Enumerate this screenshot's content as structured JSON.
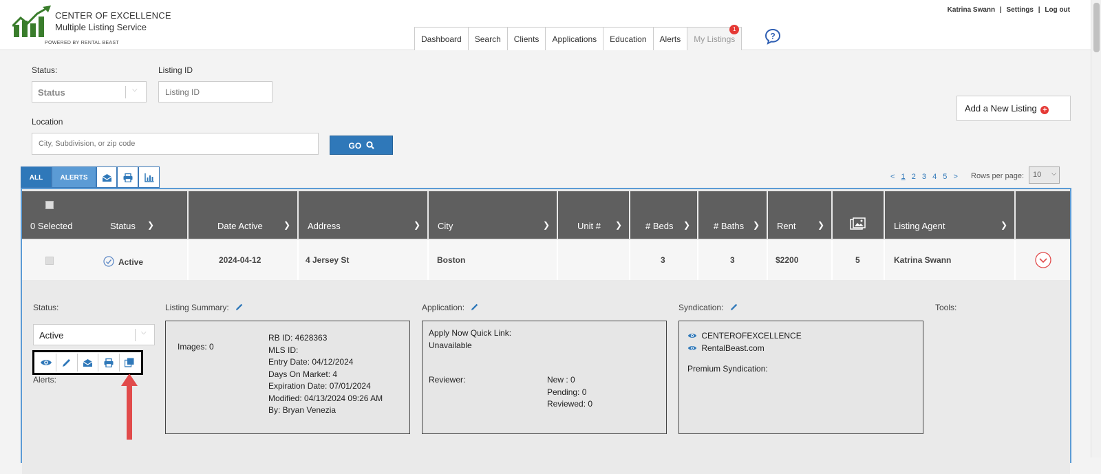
{
  "brand": {
    "line1": "CENTER OF  EXCELLENCE",
    "line2": "Multiple Listing  Service",
    "line3": "POWERED BY RENTAL BEAST",
    "color": "#3a7d2c"
  },
  "user_nav": {
    "name": "Katrina Swann",
    "settings": "Settings",
    "logout": "Log out",
    "sep": "|"
  },
  "tabs": [
    {
      "label": "Dashboard"
    },
    {
      "label": "Search"
    },
    {
      "label": "Clients"
    },
    {
      "label": "Applications"
    },
    {
      "label": "Education"
    },
    {
      "label": "Alerts"
    },
    {
      "label": "My Listings",
      "badge": "1",
      "active": true
    }
  ],
  "filters": {
    "status_label": "Status:",
    "status_value": "Status",
    "listing_id_label": "Listing ID",
    "listing_id_placeholder": "Listing ID",
    "location_label": "Location",
    "location_placeholder": "City, Subdivision, or zip code",
    "go_label": "GO"
  },
  "add_listing_label": "Add a New Listing",
  "toolbar": {
    "all": "ALL",
    "alerts": "ALERTS"
  },
  "pager": {
    "prev": "<",
    "pages": [
      "1",
      "2",
      "3",
      "4",
      "5"
    ],
    "next": ">",
    "rows_label": "Rows per page:",
    "rows_value": "10"
  },
  "columns": {
    "selected": "0 Selected",
    "status": "Status",
    "date_active": "Date Active",
    "address": "Address",
    "city": "City",
    "unit": "Unit #",
    "beds": "# Beds",
    "baths": "# Baths",
    "rent": "Rent",
    "agent": "Listing Agent"
  },
  "listing": {
    "status": "Active",
    "date_active": "2024-04-12",
    "address": "4 Jersey St",
    "city": "Boston",
    "unit": "",
    "beds": "3",
    "baths": "3",
    "rent": "$2200",
    "images": "5",
    "agent": "Katrina Swann"
  },
  "detail": {
    "status_label": "Status:",
    "status_value": "Active",
    "alerts_label": "Alerts:",
    "summary_label": "Listing Summary:",
    "application_label": "Application:",
    "syndication_label": "Syndication:",
    "tools_label": "Tools:",
    "summary": {
      "images": "Images: 0",
      "rb_id": "RB ID: 4628363",
      "mls_id": "MLS ID:",
      "entry_date": "Entry Date: 04/12/2024",
      "days_on_market": "Days On Market: 4",
      "expiration_date": "Expiration Date: 07/01/2024",
      "modified": "Modified: 04/13/2024 09:26 AM",
      "by": "By: Bryan Venezia"
    },
    "application": {
      "quick_link_label": "Apply Now Quick Link:",
      "quick_link_value": "Unavailable",
      "reviewer_label": "Reviewer:",
      "new": "New : 0",
      "pending": "Pending: 0",
      "reviewed": "Reviewed: 0"
    },
    "syndication": {
      "site1": "CENTEROFEXCELLENCE",
      "site2": "RentalBeast.com",
      "premium": "Premium Syndication:"
    }
  },
  "colors": {
    "primary": "#2f78b9",
    "header_bg": "#5f5f5f",
    "badge": "#e53935",
    "annotation_arrow": "#e14b4b"
  }
}
